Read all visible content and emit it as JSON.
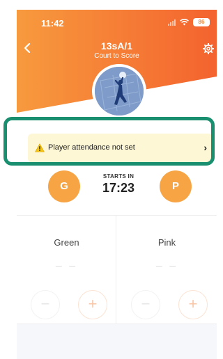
{
  "status_bar": {
    "time": "11:42",
    "battery": "86"
  },
  "header": {
    "title": "13sA/1",
    "subtitle": "Court to Score",
    "back_icon": "chevron-left-icon",
    "settings_icon": "gear-icon",
    "gradient_colors": [
      "#f58d3a",
      "#f4632e"
    ]
  },
  "avatar": {
    "icon": "netball-player-image"
  },
  "attendance": {
    "text": "Player attendance not set",
    "icon": "warning-icon",
    "chevron": "›"
  },
  "match": {
    "starts_label": "STARTS IN",
    "starts_time": "17:23",
    "team_left_badge": "G",
    "team_right_badge": "P"
  },
  "teams": [
    {
      "name": "Green",
      "score": "– –",
      "minus": "−",
      "plus": "+"
    },
    {
      "name": "Pink",
      "score": "– –",
      "minus": "−",
      "plus": "+"
    }
  ],
  "colors": {
    "accent": "#f7a544",
    "highlight": "#1a8f6f",
    "banner": "#fdf7d6"
  }
}
